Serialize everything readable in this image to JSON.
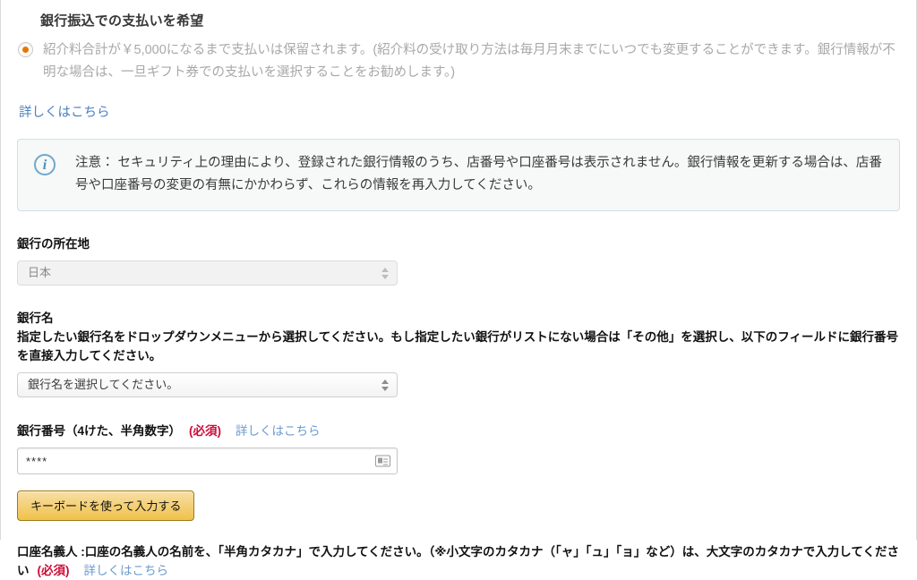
{
  "section": {
    "heading": "銀行振込での支払いを希望"
  },
  "radio_option": {
    "selected": true,
    "text": "紹介料合計が￥5,000になるまで支払いは保留されます。(紹介料の受け取り方法は毎月月末までにいつでも変更することができます。銀行情報が不明な場合は、一旦ギフト券での支払いを選択することをお勧めします。)",
    "learn_more_label": "詳しくはこちら"
  },
  "notice": {
    "icon": "info-icon",
    "text": "注意： セキュリティ上の理由により、登録された銀行情報のうち、店番号や口座番号は表示されません。銀行情報を更新する場合は、店番号や口座番号の変更の有無にかかわらず、これらの情報を再入力してください。"
  },
  "bank_location": {
    "label": "銀行の所在地",
    "value": "日本",
    "disabled": true
  },
  "bank_name": {
    "label": "銀行名",
    "description": "指定したい銀行名をドロップダウンメニューから選択してください。もし指定したい銀行がリストにない場合は「その他」を選択し、以下のフィールドに銀行番号を直接入力してください。",
    "value": "銀行名を選択してください。"
  },
  "bank_number": {
    "label": "銀行番号（4けた、半角数字）",
    "required_label": "(必須)",
    "learn_more_label": "詳しくはこちら",
    "value": "****",
    "placeholder": "",
    "autofill_icon": "contact-card-icon"
  },
  "keyboard_button": {
    "label": "キーボードを使って入力する"
  },
  "account_holder": {
    "text": "口座名義人 :口座の名義人の名前を、「半角カタカナ」で入力してください。（※小文字のカタカナ（「ャ」「ュ」「ョ」など）は、大文字のカタカナで入力してください",
    "required_label": "(必須)",
    "learn_more_label": "詳しくはこちら"
  },
  "colors": {
    "accent_orange": "#e77600",
    "link_blue": "#4a80c4",
    "required_red": "#cc0c39",
    "notice_border": "#cfe0ec",
    "notice_bg": "#f7f8f8",
    "button_yellow": "#f0c14b"
  }
}
